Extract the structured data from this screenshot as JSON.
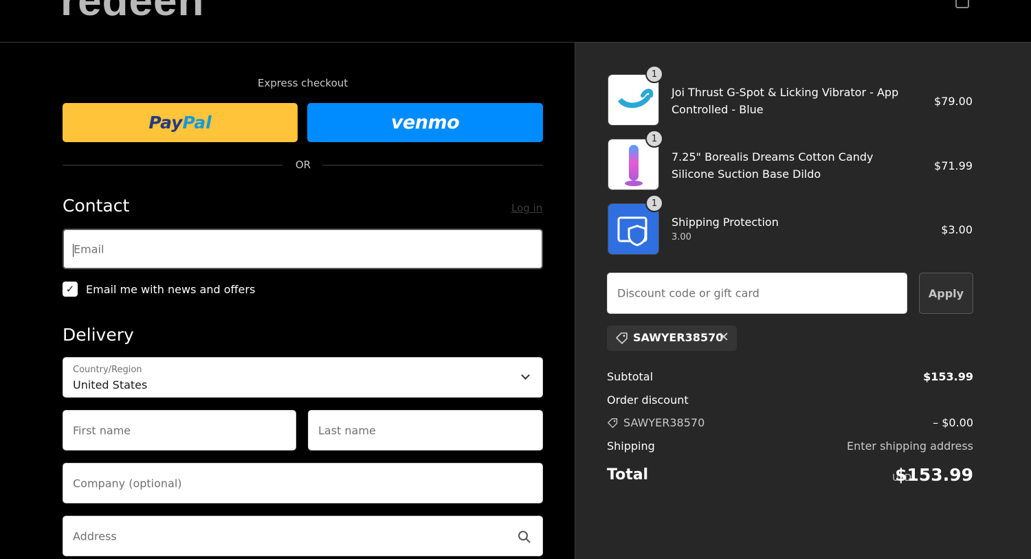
{
  "header": {
    "logo": "redeeh"
  },
  "express": {
    "title": "Express checkout",
    "paypal_a": "Pay",
    "paypal_b": "Pal",
    "venmo": "venmo",
    "or": "OR"
  },
  "contact": {
    "heading": "Contact",
    "login": "Log in",
    "email_placeholder": "Email",
    "news_label": "Email me with news and offers",
    "news_checked": true
  },
  "delivery": {
    "heading": "Delivery",
    "country_label": "Country/Region",
    "country_value": "United States",
    "first_name_placeholder": "First name",
    "last_name_placeholder": "Last name",
    "company_placeholder": "Company (optional)",
    "address_placeholder": "Address"
  },
  "cart": {
    "items": [
      {
        "name": "Joi Thrust G-Spot & Licking Vibrator - App Controlled - Blue",
        "price": "$79.00",
        "qty": "1",
        "thumb_color": "#29a7d6"
      },
      {
        "name": "7.25\" Borealis Dreams Cotton Candy Silicone Suction Base Dildo",
        "price": "$71.99",
        "qty": "1",
        "thumb_color": "#d96bd8"
      },
      {
        "name": "Shipping Protection",
        "sub": "3.00",
        "price": "$3.00",
        "qty": "1",
        "thumb_color": "#2f6fe0"
      }
    ],
    "discount_placeholder": "Discount code or gift card",
    "apply_label": "Apply",
    "applied_code": "SAWYER38570"
  },
  "summary": {
    "subtotal_label": "Subtotal",
    "subtotal_value": "$153.99",
    "order_discount_label": "Order discount",
    "discount_code": "SAWYER38570",
    "discount_value": "– $0.00",
    "shipping_label": "Shipping",
    "shipping_value": "Enter shipping address",
    "total_label": "Total",
    "currency": "USD",
    "total_value": "$153.99"
  }
}
